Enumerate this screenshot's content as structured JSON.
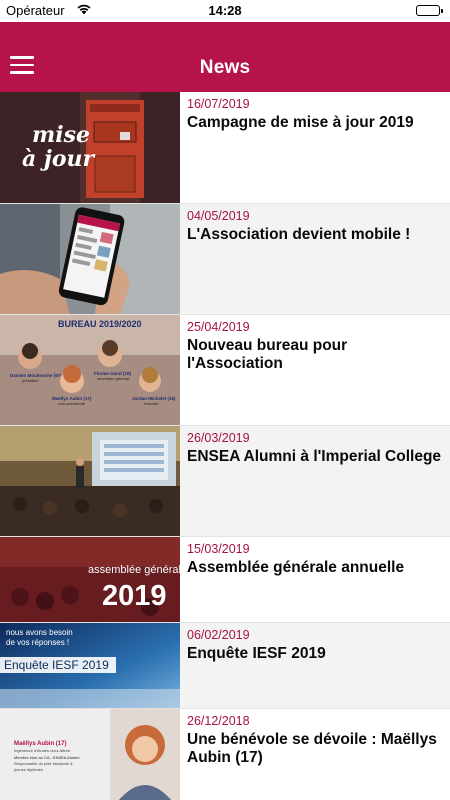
{
  "status_bar": {
    "carrier": "Opérateur",
    "time": "14:28",
    "battery_level": 1.0
  },
  "nav": {
    "title": "News",
    "menu_icon": "hamburger-menu-icon",
    "accent_color": "#b5134a"
  },
  "news": [
    {
      "date": "16/07/2019",
      "title": "Campagne de mise à jour 2019",
      "thumb_text": [
        "mise",
        "à jour"
      ]
    },
    {
      "date": "04/05/2019",
      "title": "L'Association devient mobile !"
    },
    {
      "date": "25/04/2019",
      "title": "Nouveau bureau pour l'Association",
      "thumb_text": [
        "BUREAU 2019/2020",
        "Damien Moulmoche (97)",
        "président",
        "Florian Garel (18)",
        "secrétaire général",
        "Maëllys Aubin (17)",
        "vice-présidente",
        "Jordan Michelet (16)",
        "trésorier"
      ]
    },
    {
      "date": "26/03/2019",
      "title": "ENSEA Alumni à l'Imperial College"
    },
    {
      "date": "15/03/2019",
      "title": "Assemblée générale annuelle",
      "thumb_text": [
        "assemblée générale",
        "2019"
      ]
    },
    {
      "date": "06/02/2019",
      "title": "Enquête IESF 2019",
      "thumb_text": [
        "nous avons besoin",
        "de vos réponses !",
        "Enquête IESF 2019"
      ]
    },
    {
      "date": "26/12/2018",
      "title": "Une bénévole se dévoile : Maëllys Aubin (17)",
      "thumb_text": [
        "Maëllys Aubin (17)",
        "Ingénieure d'études chez Altran",
        "Membre élue au CA - ENSEA Alumni",
        "Responsable du pôle étudiants &",
        "jeunes diplômés"
      ]
    }
  ]
}
